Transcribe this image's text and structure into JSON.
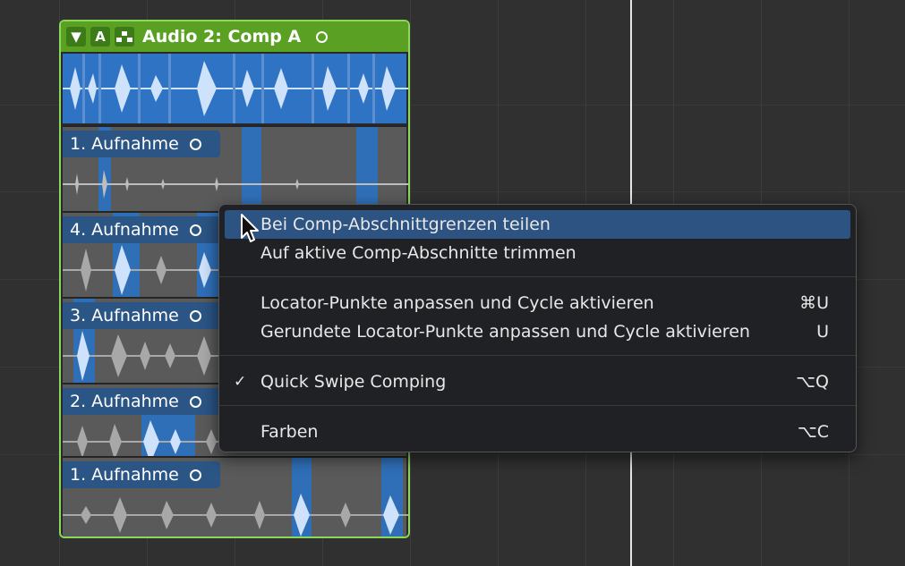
{
  "folder": {
    "title": "Audio 2: Comp A",
    "disclosure_glyph": "▼",
    "auto_button": "A",
    "icons": [
      "disclosure-icon",
      "automation-icon",
      "comp-group-icon",
      "comp-status-icon"
    ]
  },
  "lanes": [
    {
      "label": "1. Aufnahme"
    },
    {
      "label": "4. Aufnahme"
    },
    {
      "label": "3. Aufnahme"
    },
    {
      "label": "2. Aufnahme"
    },
    {
      "label": "1. Aufnahme"
    }
  ],
  "context_menu": {
    "items": [
      {
        "label": "Bei Comp-Abschnittgrenzen teilen",
        "shortcut": "",
        "highlighted": true
      },
      {
        "label": "Auf aktive Comp-Abschnitte trimmen",
        "shortcut": ""
      },
      {
        "label": "Locator-Punkte anpassen und Cycle aktivieren",
        "shortcut": "⌘U"
      },
      {
        "label": "Gerundete Locator-Punkte anpassen und Cycle aktivieren",
        "shortcut": "U"
      },
      {
        "label": "Quick Swipe Comping",
        "shortcut": "⌥Q",
        "checked": true,
        "check_glyph": "✓"
      },
      {
        "label": "Farben",
        "shortcut": "⌥C"
      }
    ]
  },
  "colors": {
    "folder_accent": "#5aa022",
    "selection_blue": "#2f6fb8",
    "menu_highlight": "#2c5382"
  }
}
